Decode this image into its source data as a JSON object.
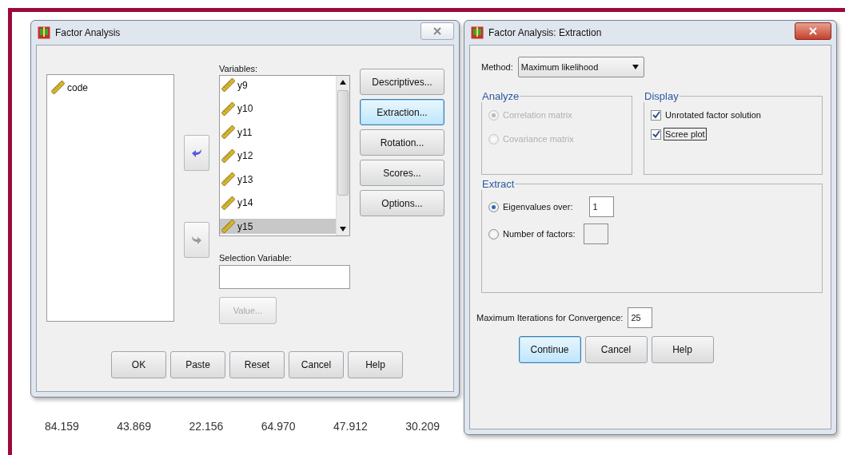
{
  "main_dialog": {
    "title": "Factor Analysis",
    "source_list": [
      {
        "name": "code"
      }
    ],
    "move_buttons": [
      {
        "disabled": false
      },
      {
        "disabled": true
      }
    ],
    "variables_label": "Variables:",
    "variables": [
      {
        "name": "y9",
        "selected": false
      },
      {
        "name": "y10",
        "selected": false
      },
      {
        "name": "y11",
        "selected": false
      },
      {
        "name": "y12",
        "selected": false
      },
      {
        "name": "y13",
        "selected": false
      },
      {
        "name": "y14",
        "selected": false
      },
      {
        "name": "y15",
        "selected": true
      }
    ],
    "selection_variable_label": "Selection Variable:",
    "value_button": {
      "label": "Value...",
      "disabled": true
    },
    "side_buttons": [
      {
        "label": "Descriptives...",
        "focused": false
      },
      {
        "label": "Extraction...",
        "focused": true
      },
      {
        "label": "Rotation...",
        "focused": false
      },
      {
        "label": "Scores...",
        "focused": false
      },
      {
        "label": "Options...",
        "focused": false
      }
    ],
    "bottom_buttons": [
      "OK",
      "Paste",
      "Reset",
      "Cancel",
      "Help"
    ]
  },
  "data_row": [
    "84.159",
    "43.869",
    "22.156",
    "64.970",
    "47.912",
    "30.209"
  ],
  "extraction_dialog": {
    "title": "Factor Analysis: Extraction",
    "method_label": "Method:",
    "method": "Maximum likelihood",
    "analyze": {
      "title": "Analyze",
      "options": [
        {
          "label": "Correlation matrix",
          "selected": true,
          "disabled": true
        },
        {
          "label": "Covariance matrix",
          "selected": false,
          "disabled": true
        }
      ]
    },
    "display": {
      "title": "Display",
      "options": [
        {
          "label": "Unrotated factor solution",
          "checked": true,
          "focused": false
        },
        {
          "label": "Scree plot",
          "checked": true,
          "focused": true
        }
      ]
    },
    "extract": {
      "title": "Extract",
      "options": [
        {
          "label": "Eigenvalues over:",
          "selected": true,
          "value": "1"
        },
        {
          "label": "Number of factors:",
          "selected": false
        }
      ]
    },
    "iterations_label": "Maximum Iterations for Convergence:",
    "iterations": "25",
    "buttons": [
      {
        "label": "Continue",
        "default": true
      },
      {
        "label": "Cancel",
        "default": false
      },
      {
        "label": "Help",
        "default": false
      }
    ]
  }
}
